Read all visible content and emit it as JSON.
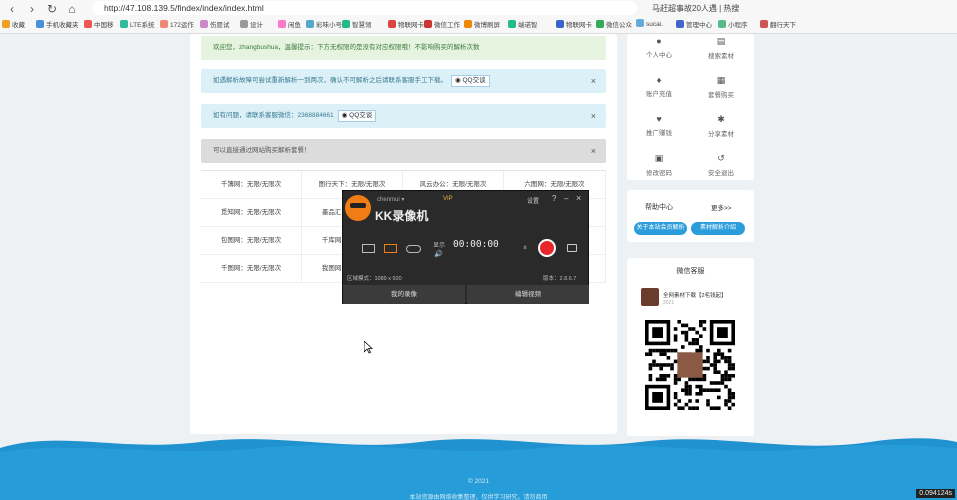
{
  "browser": {
    "url": "http://47.108.139.5/findex/index/index.html",
    "search": "马赶超事故20人遇 | 热搜",
    "bookmarks": [
      "收藏",
      "手机收藏夹",
      "中国移",
      "LTE系统",
      "172运作",
      "伤愿试",
      "设计",
      "闲鱼",
      "彩味小号",
      "智慧领",
      "物联网卡",
      "微信工作",
      "微博刷屏",
      "端诺智",
      "物联网卡",
      "微信公众",
      "sucai.",
      "管理中心",
      "小程序",
      "翻行天下"
    ]
  },
  "alerts": [
    {
      "text": "欢迎您，zhangbushua，温馨提示：下方无权限的是没有对应权限哦！不影响购买的解析次数",
      "color": "#e6f3df",
      "fg": "#3c7a3c"
    },
    {
      "text": "如遇解析故障可尝试重新解析一到两次，确认不可解析之后请联系客服手工下载。",
      "qq": "QQ交谈",
      "color": "#dcf1f7",
      "fg": "#3b7a93",
      "close": "×"
    },
    {
      "text": "如有问题，请联系客服微信：2368884661",
      "qq": "QQ交谈",
      "color": "#dcf1f7",
      "fg": "#3b7a93",
      "close": "×"
    },
    {
      "text": "可以直接通过网站购买解析套餐！",
      "color": "#dcdcdc",
      "fg": "#555",
      "close": "×"
    }
  ],
  "table": [
    [
      "千簿网：无限/无限次",
      "图行天下：无限/无限次",
      "风云办公：无限/无限次",
      "六图网：无限/无限次"
    ],
    [
      "觅知网：无限/无限次",
      "墨品汇：无限/无限次",
      "",
      ""
    ],
    [
      "包图网：无限/无限次",
      "千库网：无限/无限次",
      "",
      ""
    ],
    [
      "千图网：无限/无限次",
      "我图网：无限/无限次",
      "",
      ""
    ]
  ],
  "sidebar": {
    "items": [
      {
        "label": "个人中心",
        "icon": "user-icon"
      },
      {
        "label": "搜索素材",
        "icon": "search-icon"
      },
      {
        "label": "账户充值",
        "icon": "wallet-icon"
      },
      {
        "label": "套餐购买",
        "icon": "package-icon"
      },
      {
        "label": "推广赚钱",
        "icon": "promote-icon"
      },
      {
        "label": "分享素材",
        "icon": "share-icon"
      },
      {
        "label": "修改密码",
        "icon": "lock-icon"
      },
      {
        "label": "安全退出",
        "icon": "logout-icon"
      }
    ]
  },
  "help": {
    "title": "帮助中心",
    "more": "更多>>",
    "btn1": "关于本站会员解析",
    "btn2": "素材解析介绍"
  },
  "weibo": {
    "title": "微信客服",
    "name": "全网素材下载【2毛钱起】",
    "sub": "2021"
  },
  "kk": {
    "account": "chenmui ▾",
    "vip": "VIP",
    "logo": "KK录像机",
    "settings": "设置",
    "help": "?",
    "min": "–",
    "close": "×",
    "mode_label": "显示",
    "time": "00:00:00",
    "res": "区域模式：1089 x 920",
    "ver": "版本：2.8.6.7",
    "tab1": "我的录像",
    "tab2": "编辑视频"
  },
  "footer": {
    "copy": "© 2021",
    "link": "本站资源由网络收集整理，仅供学习研究，请勿商用"
  },
  "timer": "0.094124s",
  "colors": {
    "accent": "#2c9ddb",
    "wave": "#1f92cf",
    "record": "#e8262b"
  }
}
